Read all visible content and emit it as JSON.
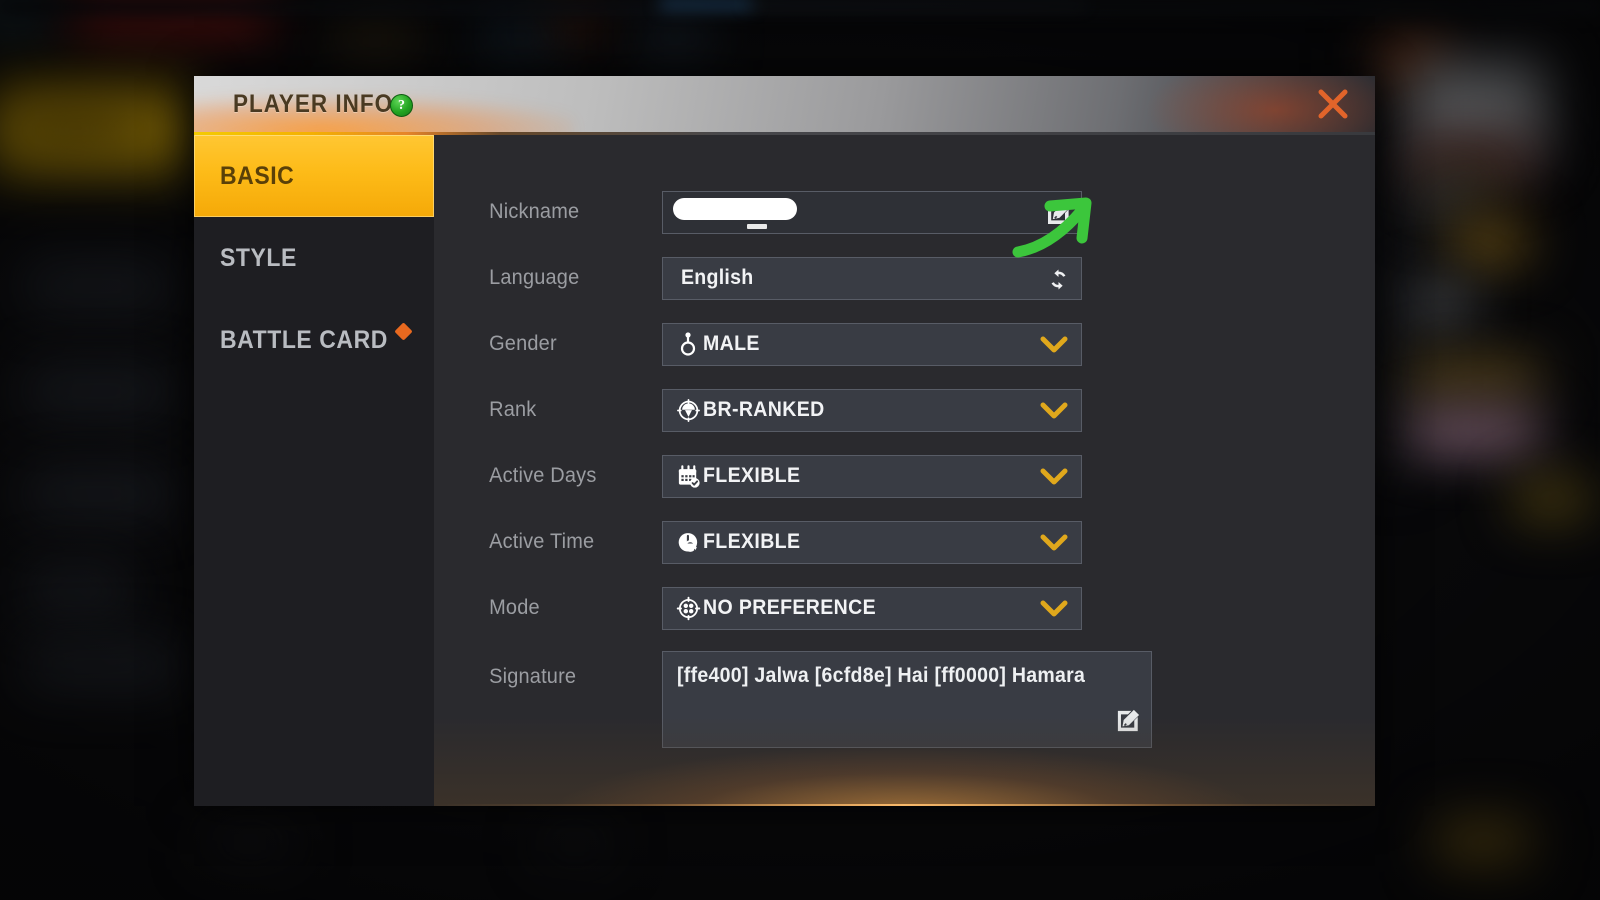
{
  "window": {
    "title": "PLAYER INFO",
    "help_badge": "?",
    "close_icon": "close-icon",
    "accent_color": "#fdbb18",
    "close_color": "#e2642a",
    "help_color": "#22a421"
  },
  "sidebar": {
    "items": [
      {
        "label": "BASIC",
        "active": true,
        "badge": false
      },
      {
        "label": "STYLE",
        "active": false,
        "badge": false
      },
      {
        "label": "BATTLE CARD",
        "active": false,
        "badge": true
      }
    ],
    "badge_color": "#e8691f"
  },
  "form": {
    "rows": [
      {
        "label": "Nickname",
        "value": "",
        "icon": "",
        "control": "text-redacted",
        "action_icon": "edit-icon"
      },
      {
        "label": "Language",
        "value": "English",
        "icon": "",
        "control": "text",
        "action_icon": "refresh-icon"
      },
      {
        "label": "Gender",
        "value": "MALE",
        "icon": "male-symbol-icon",
        "control": "dropdown",
        "action_icon": "chevron-down-icon"
      },
      {
        "label": "Rank",
        "value": "BR-RANKED",
        "icon": "parachute-icon",
        "control": "dropdown",
        "action_icon": "chevron-down-icon"
      },
      {
        "label": "Active Days",
        "value": "FLEXIBLE",
        "icon": "calendar-icon",
        "control": "dropdown",
        "action_icon": "chevron-down-icon"
      },
      {
        "label": "Active Time",
        "value": "FLEXIBLE",
        "icon": "clock-icon",
        "control": "dropdown",
        "action_icon": "chevron-down-icon"
      },
      {
        "label": "Mode",
        "value": "NO PREFERENCE",
        "icon": "crosshair-icon",
        "control": "dropdown",
        "action_icon": "chevron-down-icon"
      }
    ],
    "signature": {
      "label": "Signature",
      "value": "[ffe400] Jalwa [6cfd8e] Hai [ff0000] Hamara",
      "action_icon": "edit-icon"
    }
  },
  "annotation": {
    "arrow_color": "#3cc63c",
    "points_to": "nickname-edit-icon"
  }
}
